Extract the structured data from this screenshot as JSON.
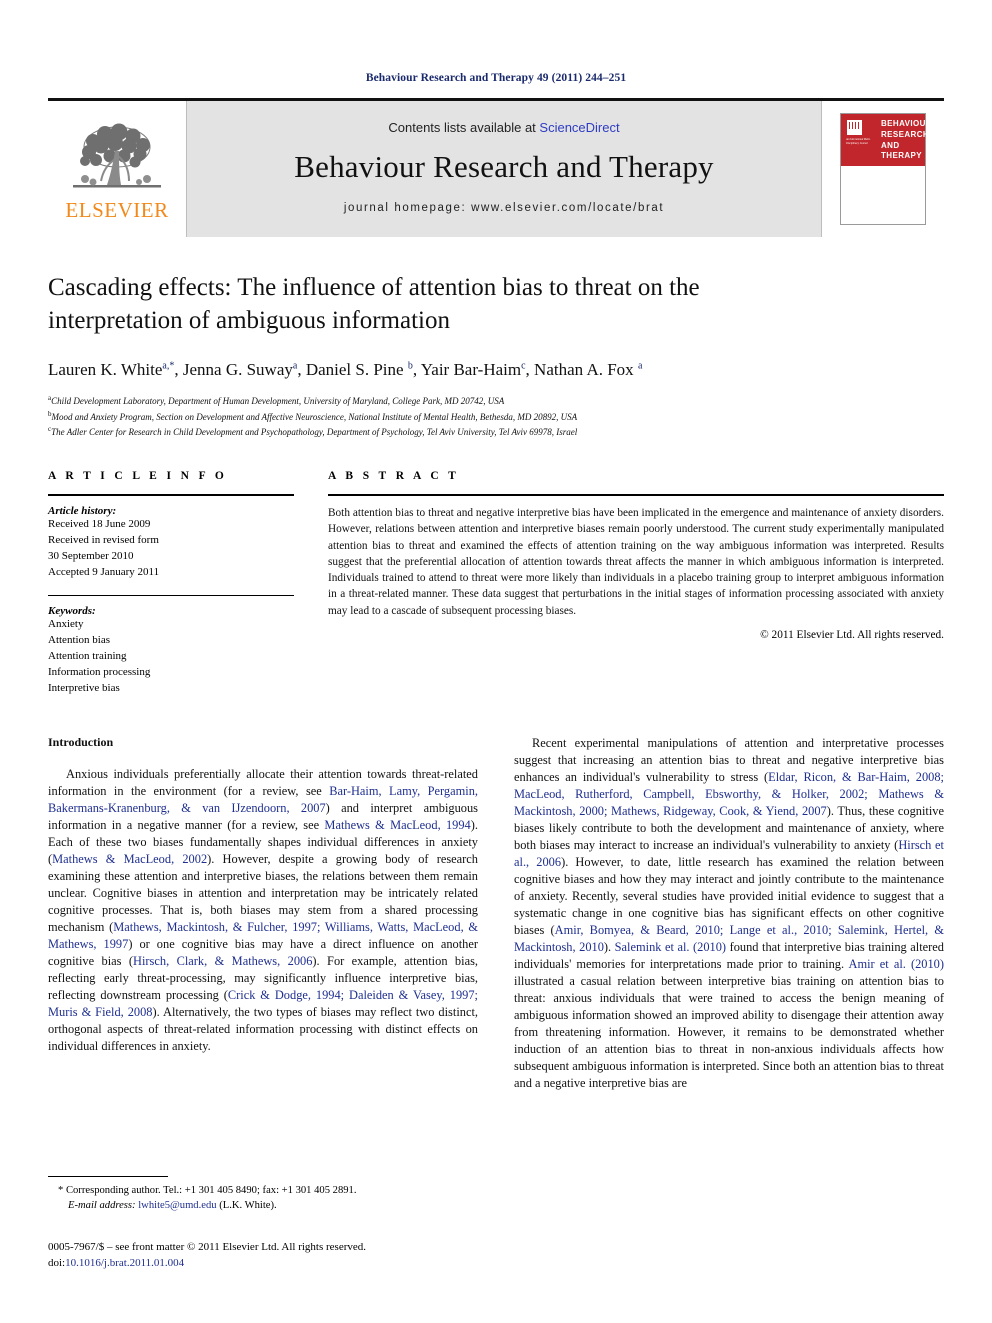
{
  "running_head": "Behaviour Research and Therapy 49 (2011) 244–251",
  "masthead": {
    "publisher_name": "ELSEVIER",
    "contents_prefix": "Contents lists available at ",
    "contents_link": "ScienceDirect",
    "journal_title": "Behaviour Research and Therapy",
    "homepage": "journal homepage: www.elsevier.com/locate/brat",
    "cover_title": "BEHAVIOUR RESEARCH AND THERAPY",
    "cover_subtitle": "An International Multi-Disciplinary Journal"
  },
  "article": {
    "title": "Cascading effects: The influence of attention bias to threat on the interpretation of ambiguous information",
    "authors": [
      {
        "name": "Lauren K. White",
        "marks": "a,*"
      },
      {
        "name": "Jenna G. Suway",
        "marks": "a"
      },
      {
        "name": "Daniel S. Pine",
        "marks": "b"
      },
      {
        "name": "Yair Bar-Haim",
        "marks": "c"
      },
      {
        "name": "Nathan A. Fox",
        "marks": "a"
      }
    ],
    "affiliations": [
      {
        "mark": "a",
        "text": "Child Development Laboratory, Department of Human Development, University of Maryland, College Park, MD 20742, USA"
      },
      {
        "mark": "b",
        "text": "Mood and Anxiety Program, Section on Development and Affective Neuroscience, National Institute of Mental Health, Bethesda, MD 20892, USA"
      },
      {
        "mark": "c",
        "text": "The Adler Center for Research in Child Development and Psychopathology, Department of Psychology, Tel Aviv University, Tel Aviv 69978, Israel"
      }
    ]
  },
  "article_info": {
    "heading": "A R T I C L E  I N F O",
    "history_label": "Article history:",
    "history": [
      "Received 18 June 2009",
      "Received in revised form",
      "30 September 2010",
      "Accepted 9 January 2011"
    ],
    "keywords_label": "Keywords:",
    "keywords": [
      "Anxiety",
      "Attention bias",
      "Attention training",
      "Information processing",
      "Interpretive bias"
    ]
  },
  "abstract": {
    "heading": "A B S T R A C T",
    "text": "Both attention bias to threat and negative interpretive bias have been implicated in the emergence and maintenance of anxiety disorders. However, relations between attention and interpretive biases remain poorly understood. The current study experimentally manipulated attention bias to threat and examined the effects of attention training on the way ambiguous information was interpreted. Results suggest that the preferential allocation of attention towards threat affects the manner in which ambiguous information is interpreted. Individuals trained to attend to threat were more likely than individuals in a placebo training group to interpret ambiguous information in a threat-related manner. These data suggest that perturbations in the initial stages of information processing associated with anxiety may lead to a cascade of subsequent processing biases.",
    "copyright": "© 2011 Elsevier Ltd. All rights reserved."
  },
  "body": {
    "intro_heading": "Introduction",
    "left_paragraph_1_a": "Anxious individuals preferentially allocate their attention towards threat-related information in the environment (for a review, see ",
    "left_cite_1": "Bar-Haim, Lamy, Pergamin, Bakermans-Kranenburg, & van IJzendoorn, 2007",
    "left_paragraph_1_b": ") and interpret ambiguous information in a negative manner (for a review, see ",
    "left_cite_2": "Mathews & MacLeod, 1994",
    "left_paragraph_1_c": "). Each of these two biases fundamentally shapes individual differences in anxiety (",
    "left_cite_3": "Mathews & MacLeod, 2002",
    "left_paragraph_1_d": "). However, despite a growing body of research examining these attention and interpretive biases, the relations between them remain unclear. Cognitive biases in attention and interpretation may be intricately related cognitive processes. That is, both biases may stem from a shared processing mechanism (",
    "left_cite_4": "Mathews, Mackintosh, & Fulcher, 1997; Williams, Watts, MacLeod, & Mathews, 1997",
    "left_paragraph_1_e": ") or one cognitive bias may have a direct influence on another cognitive bias (",
    "left_cite_5": "Hirsch, Clark, & Mathews, 2006",
    "left_paragraph_1_f": "). For example, attention bias, reflecting early threat-processing, may significantly influence interpretive bias, reflecting downstream processing (",
    "left_cite_6": "Crick & Dodge, 1994; Daleiden & Vasey, 1997; Muris & Field, 2008",
    "left_paragraph_1_g": "). Alternatively, the two types of biases may reflect two distinct, orthogonal aspects of threat-related information processing with distinct effects on individual differences in anxiety.",
    "right_paragraph_1_a": "Recent experimental manipulations of attention and interpretative processes suggest that increasing an attention bias to threat and negative interpretive bias enhances an individual's vulnerability to stress (",
    "right_cite_1": "Eldar, Ricon, & Bar-Haim, 2008; MacLeod, Rutherford, Campbell, Ebsworthy, & Holker, 2002; Mathews & Mackintosh, 2000; Mathews, Ridgeway, Cook, & Yiend, 2007",
    "right_paragraph_1_b": "). Thus, these cognitive biases likely contribute to both the development and maintenance of anxiety, where both biases may interact to increase an individual's vulnerability to anxiety (",
    "right_cite_2": "Hirsch et al., 2006",
    "right_paragraph_1_c": "). However, to date, little research has examined the relation between cognitive biases and how they may interact and jointly contribute to the maintenance of anxiety. Recently, several studies have provided initial evidence to suggest that a systematic change in one cognitive bias has significant effects on other cognitive biases (",
    "right_cite_3": "Amir, Bomyea, & Beard, 2010; Lange et al., 2010; Salemink, Hertel, & Mackintosh, 2010",
    "right_paragraph_1_d": "). ",
    "right_cite_4": "Salemink et al. (2010)",
    "right_paragraph_1_e": " found that interpretive bias training altered individuals' memories for interpretations made prior to training. ",
    "right_cite_5": "Amir et al. (2010)",
    "right_paragraph_1_f": " illustrated a casual relation between interpretive bias training on attention bias to threat: anxious individuals that were trained to access the benign meaning of ambiguous information showed an improved ability to disengage their attention away from threatening information. However, it remains to be demonstrated whether induction of an attention bias to threat in non-anxious individuals affects how subsequent ambiguous information is interpreted. Since both an attention bias to threat and a negative interpretive bias are"
  },
  "footnote": {
    "corresponding": "* Corresponding author. Tel.: +1 301 405 8490; fax: +1 301 405 2891.",
    "email_label": "E-mail address:",
    "email": "lwhite5@umd.edu",
    "email_suffix": "(L.K. White)."
  },
  "footer": {
    "issn_line": "0005-7967/$ – see front matter © 2011 Elsevier Ltd. All rights reserved.",
    "doi_label": "doi:",
    "doi": "10.1016/j.brat.2011.01.004"
  },
  "colors": {
    "link_blue": "#1f2f8f",
    "sciencedirect_blue": "#2e3cc4",
    "elsevier_orange": "#f08a1c",
    "cover_red": "#c0262b",
    "band_gray": "#e3e3e3"
  }
}
